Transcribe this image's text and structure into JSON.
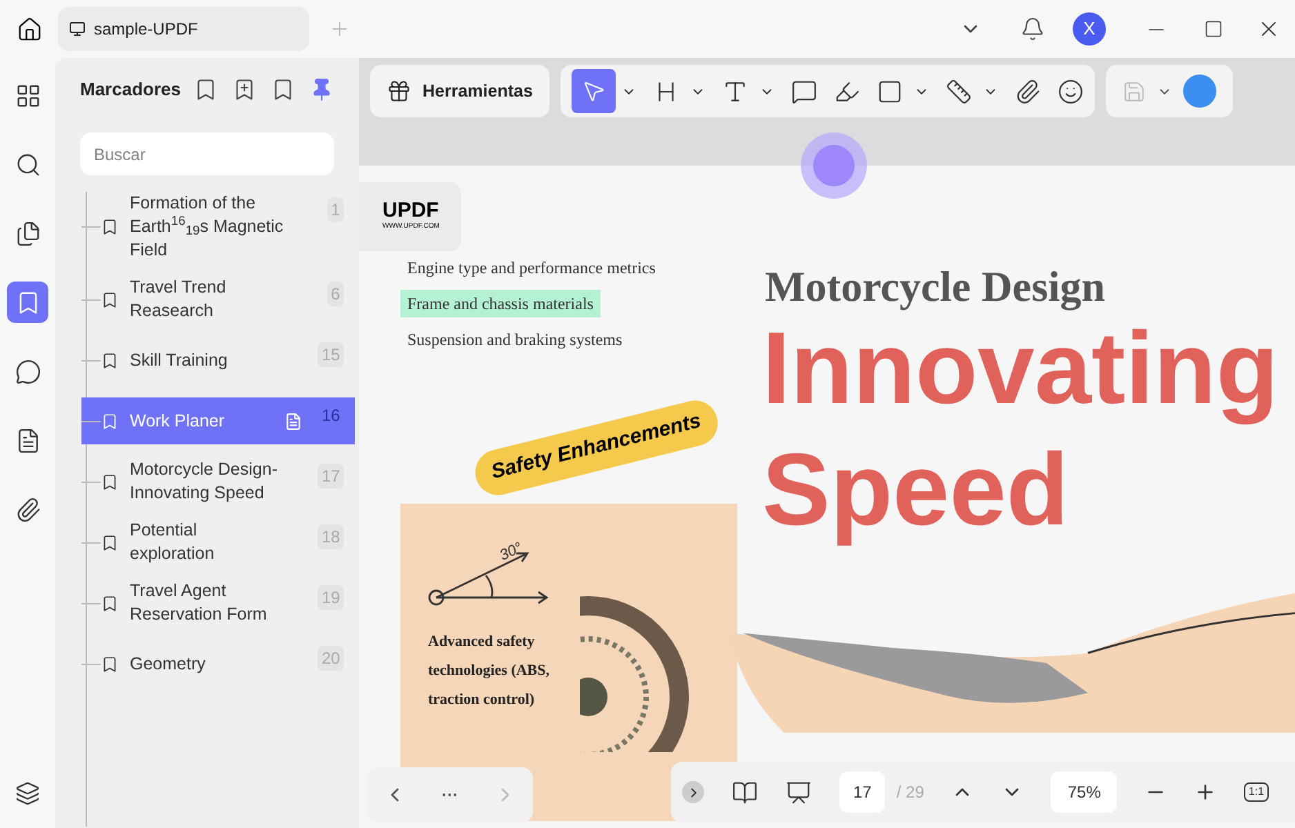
{
  "tab": {
    "title": "sample-UPDF"
  },
  "account": {
    "initial": "X"
  },
  "sidebar": {
    "title": "Marcadores",
    "search": {
      "placeholder": "Buscar"
    },
    "bookmarks": [
      {
        "title": "Formation of the Earth$^{16}$$_{19}$s Magnetic Field",
        "page": "1",
        "selected": false
      },
      {
        "title": "Travel Trend Reasearch",
        "page": "6",
        "selected": false
      },
      {
        "title": "Skill Training",
        "page": "15",
        "selected": false
      },
      {
        "title": "Work Planer",
        "page": "16",
        "selected": true
      },
      {
        "title": "Motorcycle Design-Innovating Speed",
        "page": "17",
        "selected": false
      },
      {
        "title": "Potential exploration",
        "page": "18",
        "selected": false
      },
      {
        "title": "Travel Agent Reservation Form",
        "page": "19",
        "selected": false
      },
      {
        "title": "Geometry",
        "page": "20",
        "selected": false
      }
    ]
  },
  "toolbar": {
    "tools_label": "Herramientas"
  },
  "document": {
    "logo": "UPDF",
    "logo_url": "WWW.UPDF.COM",
    "list": [
      {
        "text": "Engine type and performance metrics",
        "highlighted": false
      },
      {
        "text": "Frame and chassis materials",
        "highlighted": true
      },
      {
        "text": "Suspension and braking systems",
        "highlighted": false
      }
    ],
    "heading": "Motorcycle Design",
    "title_lines": [
      "Innovating",
      "Speed"
    ],
    "sticker": "Safety Enhancements",
    "angle": "30°",
    "card_text": "Advanced safety technologies (ABS, traction control)"
  },
  "nav": {
    "more": "···"
  },
  "pager": {
    "current": "17",
    "total": "/ 29",
    "zoom": "75%",
    "actual_size": "1:1"
  }
}
